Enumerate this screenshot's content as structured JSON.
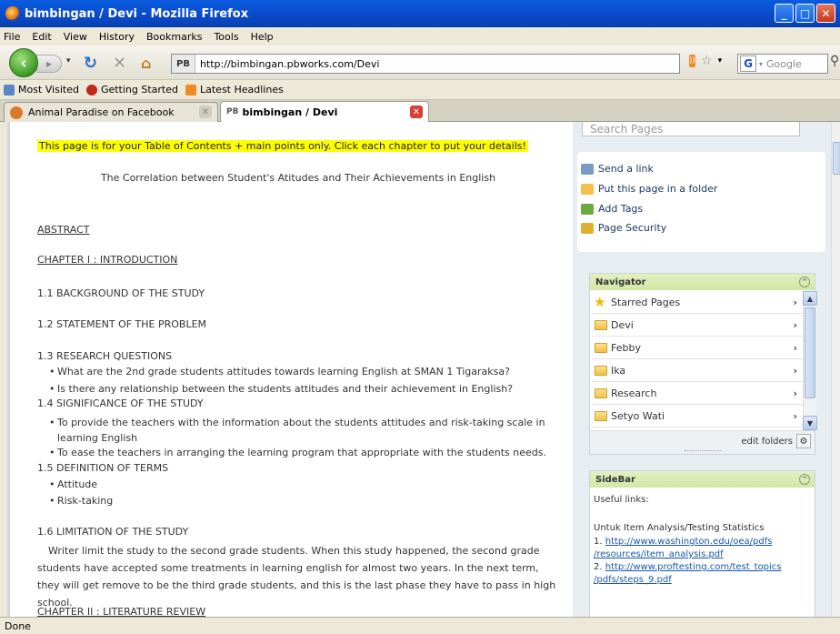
{
  "window": {
    "title": "bimbingan / Devi - Mozilla Firefox"
  },
  "menu": [
    "File",
    "Edit",
    "View",
    "History",
    "Bookmarks",
    "Tools",
    "Help"
  ],
  "nav": {
    "site_badge": "PB",
    "url": "http://bimbingan.pbworks.com/Devi",
    "search_placeholder": "Google"
  },
  "bookmarks": [
    "Most Visited",
    "Getting Started",
    "Latest Headlines"
  ],
  "tabs": [
    {
      "label": "Animal Paradise on Facebook",
      "active": false
    },
    {
      "label": "bimbingan / Devi",
      "badge": "PB",
      "active": true
    }
  ],
  "main": {
    "notice": "This page is for your Table of Contents + main points only. Click each chapter to put your details!",
    "doc_title": "The Correlation between Student's Atitudes and Their Achievements in English",
    "abstract": "ABSTRACT",
    "chapter1": "CHAPTER I : INTRODUCTION",
    "s1_1": "1.1  BACKGROUND OF THE STUDY",
    "s1_2": "1.2  STATEMENT OF THE PROBLEM",
    "s1_3": "1.3  RESEARCH QUESTIONS",
    "rq": [
      "What are the 2nd grade students attitudes towards learning English at SMAN 1 Tigaraksa?",
      "Is there any relationship between the students attitudes and their achievement in English?"
    ],
    "s1_4": "1.4  SIGNIFICANCE OF THE STUDY",
    "sig": [
      "To provide the teachers with the information about the students attitudes and risk-taking scale in learning English",
      "To ease the teachers in arranging the learning program that appropriate with the students needs."
    ],
    "s1_5": "1.5  DEFINITION OF TERMS",
    "terms": [
      "Attitude",
      "Risk-taking"
    ],
    "s1_6": "1.6  LIMITATION OF THE STUDY",
    "limitation": "Writer limit the study to the second grade students. When this study happened, the second grade students have accepted some treatments in learning english for almost two years. In the next term, they will get remove to be the third grade students, and this is the last phase they have to pass in high school.",
    "chapter2": "CHAPTER II : LITERATURE REVIEW"
  },
  "sidebar": {
    "search_placeholder": "Search Pages",
    "actions": [
      "Send a link",
      "Put this page in a folder",
      "Add Tags",
      "Page Security"
    ],
    "navigator": {
      "title": "Navigator",
      "items": [
        "Starred Pages",
        "Devi",
        "Febby",
        "Ika",
        "Research",
        "Setyo Wati"
      ],
      "edit_folders": "edit folders"
    },
    "sidebar_panel": {
      "title": "SideBar",
      "useful": "Useful links:",
      "heading": "Untuk Item Analysis/Testing Statistics",
      "link1_prefix": "1. ",
      "link1_a": "http://www.washington.edu/oea/pdfs",
      "link1_b": "/resources/item_analysis.pdf",
      "link2_prefix": "2. ",
      "link2_a": "http://www.proftesting.com/test_topics",
      "link2_b": "/pdfs/steps_9.pdf"
    }
  },
  "status": "Done",
  "colors": {
    "title_bar": "#0b4fd0",
    "highlight": "#ffff00",
    "link": "#1a55b0",
    "panel_header": "#d3e6a6"
  }
}
